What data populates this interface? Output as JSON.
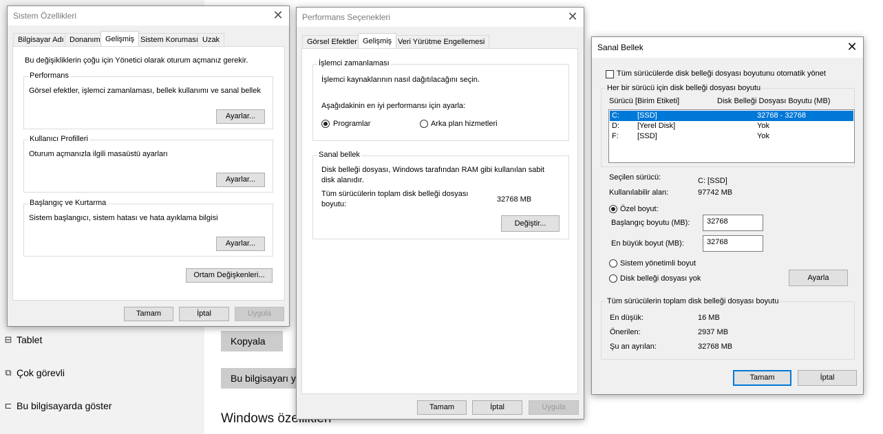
{
  "background": {
    "nav": [
      {
        "icon": "tablet-icon",
        "glyph": "⊟",
        "label": "Tablet"
      },
      {
        "icon": "multitask-icon",
        "glyph": "⧉",
        "label": "Çok görevli"
      },
      {
        "icon": "project-icon",
        "glyph": "⊏",
        "label": "Bu bilgisayarda göster"
      }
    ],
    "copy_button": "Kopyala",
    "rename_button": "Bu bilgisayarı ye",
    "heading": "Windows özellikleri"
  },
  "sysprops": {
    "title": "Sistem Özellikleri",
    "tabs": [
      "Bilgisayar Adı",
      "Donanım",
      "Gelişmiş",
      "Sistem Koruması",
      "Uzak"
    ],
    "active_tab": 2,
    "admin_note": "Bu değişikliklerin çoğu için Yönetici olarak oturum açmanız gerekir.",
    "performance": {
      "title": "Performans",
      "desc": "Görsel efektler, işlemci zamanlaması, bellek kullanımı ve sanal bellek",
      "button": "Ayarlar..."
    },
    "profiles": {
      "title": "Kullanıcı Profilleri",
      "desc": "Oturum açmanızla ilgili masaüstü ayarları",
      "button": "Ayarlar..."
    },
    "startup": {
      "title": "Başlangıç ve Kurtarma",
      "desc": "Sistem başlangıcı, sistem hatası ve hata ayıklama bilgisi",
      "button": "Ayarlar..."
    },
    "env_button": "Ortam Değişkenleri...",
    "ok": "Tamam",
    "cancel": "İptal",
    "apply": "Uygula"
  },
  "perfopts": {
    "title": "Performans Seçenekleri",
    "tabs": [
      "Görsel Efektler",
      "Gelişmiş",
      "Veri Yürütme Engellemesi"
    ],
    "active_tab": 1,
    "scheduling": {
      "title": "İşlemci zamanlaması",
      "desc": "İşlemci kaynaklarının nasıl dağıtılacağını seçin.",
      "adjust": "Aşağıdakinin en iyi performansı için ayarla:",
      "opt_programs": "Programlar",
      "opt_background": "Arka plan hizmetleri",
      "selected": "Programlar"
    },
    "virtual": {
      "title": "Sanal bellek",
      "desc1": "Disk belleği dosyası, Windows tarafından RAM gibi kullanılan sabit",
      "desc2": "disk alanıdır.",
      "total_label1": "Tüm sürücülerin toplam disk belleği dosyası",
      "total_label2": "boyutu:",
      "total_value": "32768 MB",
      "change_button": "Değiştir..."
    },
    "ok": "Tamam",
    "cancel": "İptal",
    "apply": "Uygula"
  },
  "vmem": {
    "title": "Sanal Bellek",
    "auto_manage": "Tüm sürücülerde disk belleği dosyası boyutunu otomatik yönet",
    "auto_checked": false,
    "per_drive_title": "Her bir sürücü için disk belleği dosyası boyutu",
    "col_drive": "Sürücü  [Birim Etiketi]",
    "col_size": "Disk Belleği Dosyası Boyutu (MB)",
    "drives": [
      {
        "letter": "C:",
        "label": "[SSD]",
        "size": "32768 - 32768",
        "selected": true
      },
      {
        "letter": "D:",
        "label": "[Yerel Disk]",
        "size": "Yok",
        "selected": false
      },
      {
        "letter": "F:",
        "label": "[SSD]",
        "size": "Yok",
        "selected": false
      }
    ],
    "selected_drive_label": "Seçilen sürücü:",
    "selected_drive_value": "C:  [SSD]",
    "free_space_label": "Kullanılabilir alan:",
    "free_space_value": "97742 MB",
    "custom_size": "Özel boyut:",
    "initial_label": "Başlangıç boyutu (MB):",
    "initial_value": "32768",
    "max_label": "En büyük boyut (MB):",
    "max_value": "32768",
    "system_managed": "Sistem yönetimli boyut",
    "no_paging": "Disk belleği dosyası yok",
    "selected_option": "custom",
    "set_button": "Ayarla",
    "totals_title": "Tüm sürücülerin toplam disk belleği dosyası boyutu",
    "min_label": "En düşük:",
    "min_value": "16 MB",
    "rec_label": "Önerilen:",
    "rec_value": "2937 MB",
    "cur_label": "Şu an ayrılan:",
    "cur_value": "32768 MB",
    "ok": "Tamam",
    "cancel": "İptal"
  }
}
